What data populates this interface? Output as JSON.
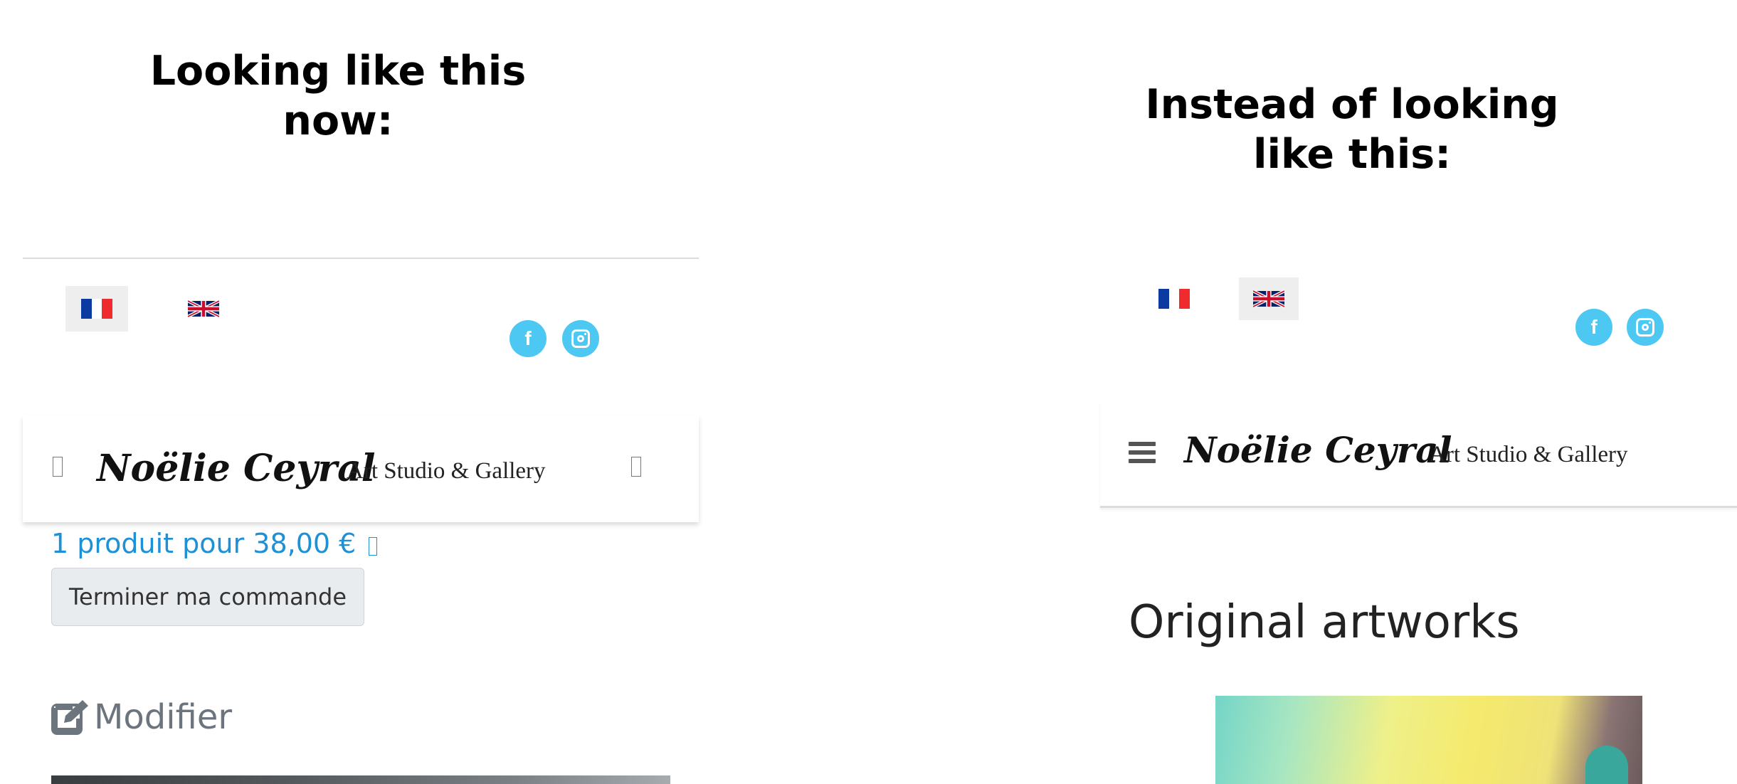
{
  "captions": {
    "left": "Looking like this now:",
    "right": "Instead of looking like this:"
  },
  "brand": {
    "script_name": "Noëlie Ceyral",
    "subtitle": "Art Studio & Gallery"
  },
  "languages": [
    {
      "code": "fr",
      "icon": "flag-fr-icon"
    },
    {
      "code": "en",
      "icon": "flag-uk-icon"
    }
  ],
  "social": [
    {
      "network": "facebook",
      "icon": "facebook-icon",
      "glyph": "f"
    },
    {
      "network": "instagram",
      "icon": "instagram-icon"
    }
  ],
  "left_panel": {
    "active_language": "fr",
    "cart_summary": "1 produit pour 38,00 €",
    "checkout_label": "Terminer ma commande",
    "edit_label": "Modifier"
  },
  "right_panel": {
    "active_language": "en",
    "section_title": "Original artworks"
  },
  "colors": {
    "social_accent": "#4cc8f2",
    "link_blue": "#1e90d6",
    "flag_active_bg": "#eeeeee"
  }
}
